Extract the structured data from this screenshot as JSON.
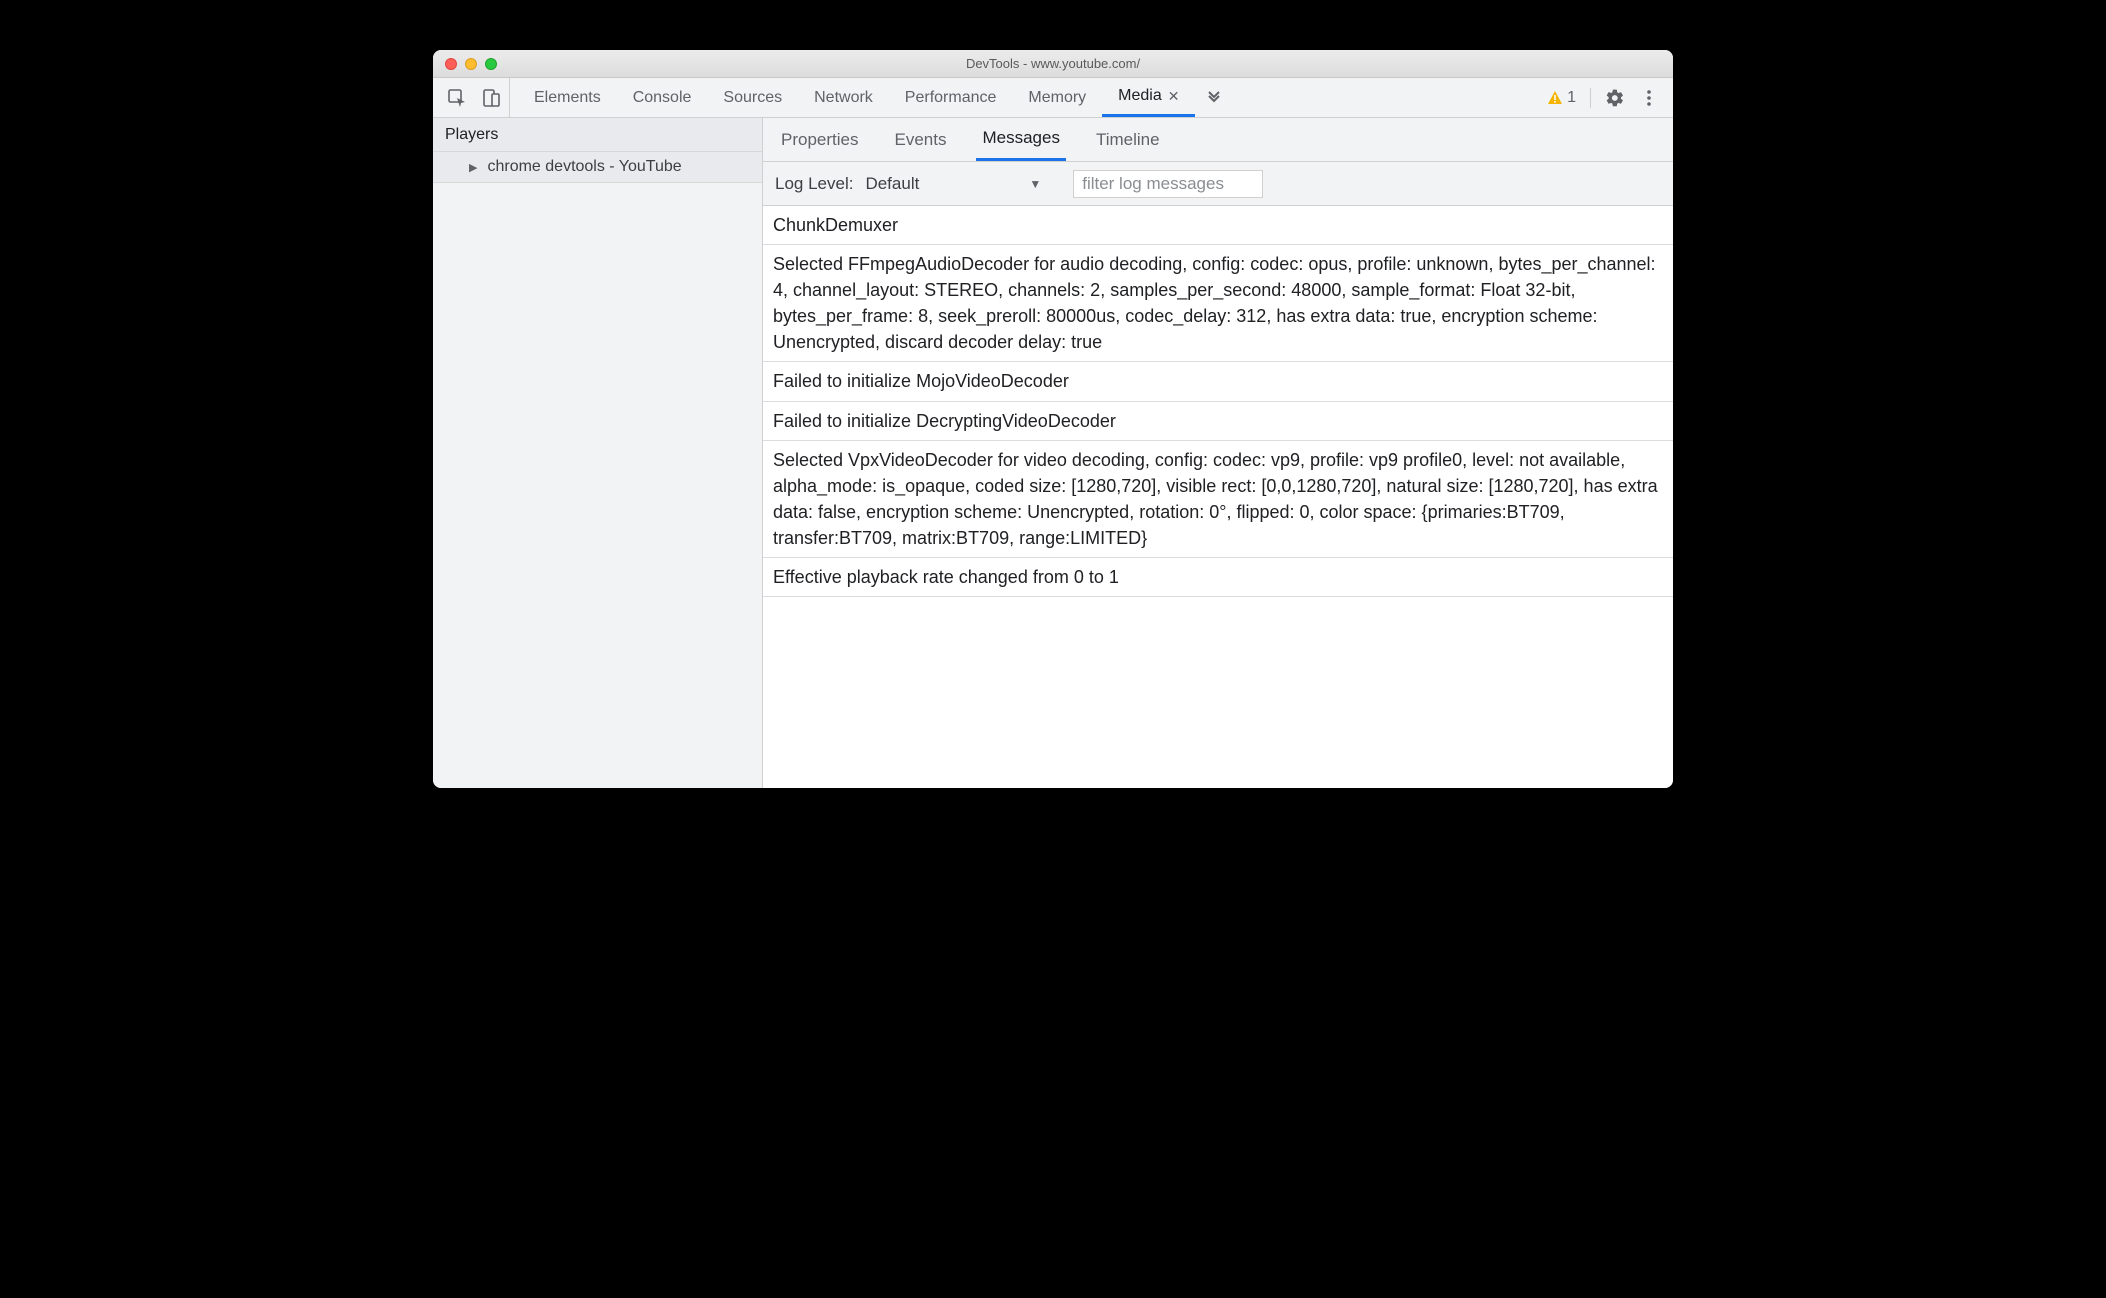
{
  "window": {
    "title": "DevTools - www.youtube.com/"
  },
  "toolbar": {
    "tabs": [
      {
        "label": "Elements"
      },
      {
        "label": "Console"
      },
      {
        "label": "Sources"
      },
      {
        "label": "Network"
      },
      {
        "label": "Performance"
      },
      {
        "label": "Memory"
      },
      {
        "label": "Media",
        "active": true,
        "closeable": true
      }
    ],
    "warning_count": "1"
  },
  "sidebar": {
    "header": "Players",
    "items": [
      {
        "label": "chrome devtools - YouTube"
      }
    ]
  },
  "media": {
    "subtabs": [
      {
        "label": "Properties"
      },
      {
        "label": "Events"
      },
      {
        "label": "Messages",
        "active": true
      },
      {
        "label": "Timeline"
      }
    ],
    "filter": {
      "label": "Log Level:",
      "value": "Default",
      "placeholder": "filter log messages"
    },
    "messages": [
      "ChunkDemuxer",
      "Selected FFmpegAudioDecoder for audio decoding, config: codec: opus, profile: unknown, bytes_per_channel: 4, channel_layout: STEREO, channels: 2, samples_per_second: 48000, sample_format: Float 32-bit, bytes_per_frame: 8, seek_preroll: 80000us, codec_delay: 312, has extra data: true, encryption scheme: Unencrypted, discard decoder delay: true",
      "Failed to initialize MojoVideoDecoder",
      "Failed to initialize DecryptingVideoDecoder",
      "Selected VpxVideoDecoder for video decoding, config: codec: vp9, profile: vp9 profile0, level: not available, alpha_mode: is_opaque, coded size: [1280,720], visible rect: [0,0,1280,720], natural size: [1280,720], has extra data: false, encryption scheme: Unencrypted, rotation: 0°, flipped: 0, color space: {primaries:BT709, transfer:BT709, matrix:BT709, range:LIMITED}",
      "Effective playback rate changed from 0 to 1"
    ]
  }
}
